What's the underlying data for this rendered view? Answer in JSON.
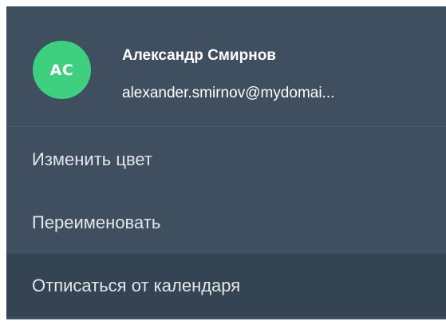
{
  "user": {
    "initials": "AC",
    "name": "Александр Смирнов",
    "email": "alexander.smirnov@mydomai..."
  },
  "menu": {
    "items": [
      {
        "label": "Изменить цвет"
      },
      {
        "label": "Переименовать"
      },
      {
        "label": "Отписаться от календаря"
      }
    ]
  },
  "colors": {
    "menu_background": "#3f4f5f",
    "hover_background": "#354452",
    "avatar_background": "#3ecf7f"
  }
}
